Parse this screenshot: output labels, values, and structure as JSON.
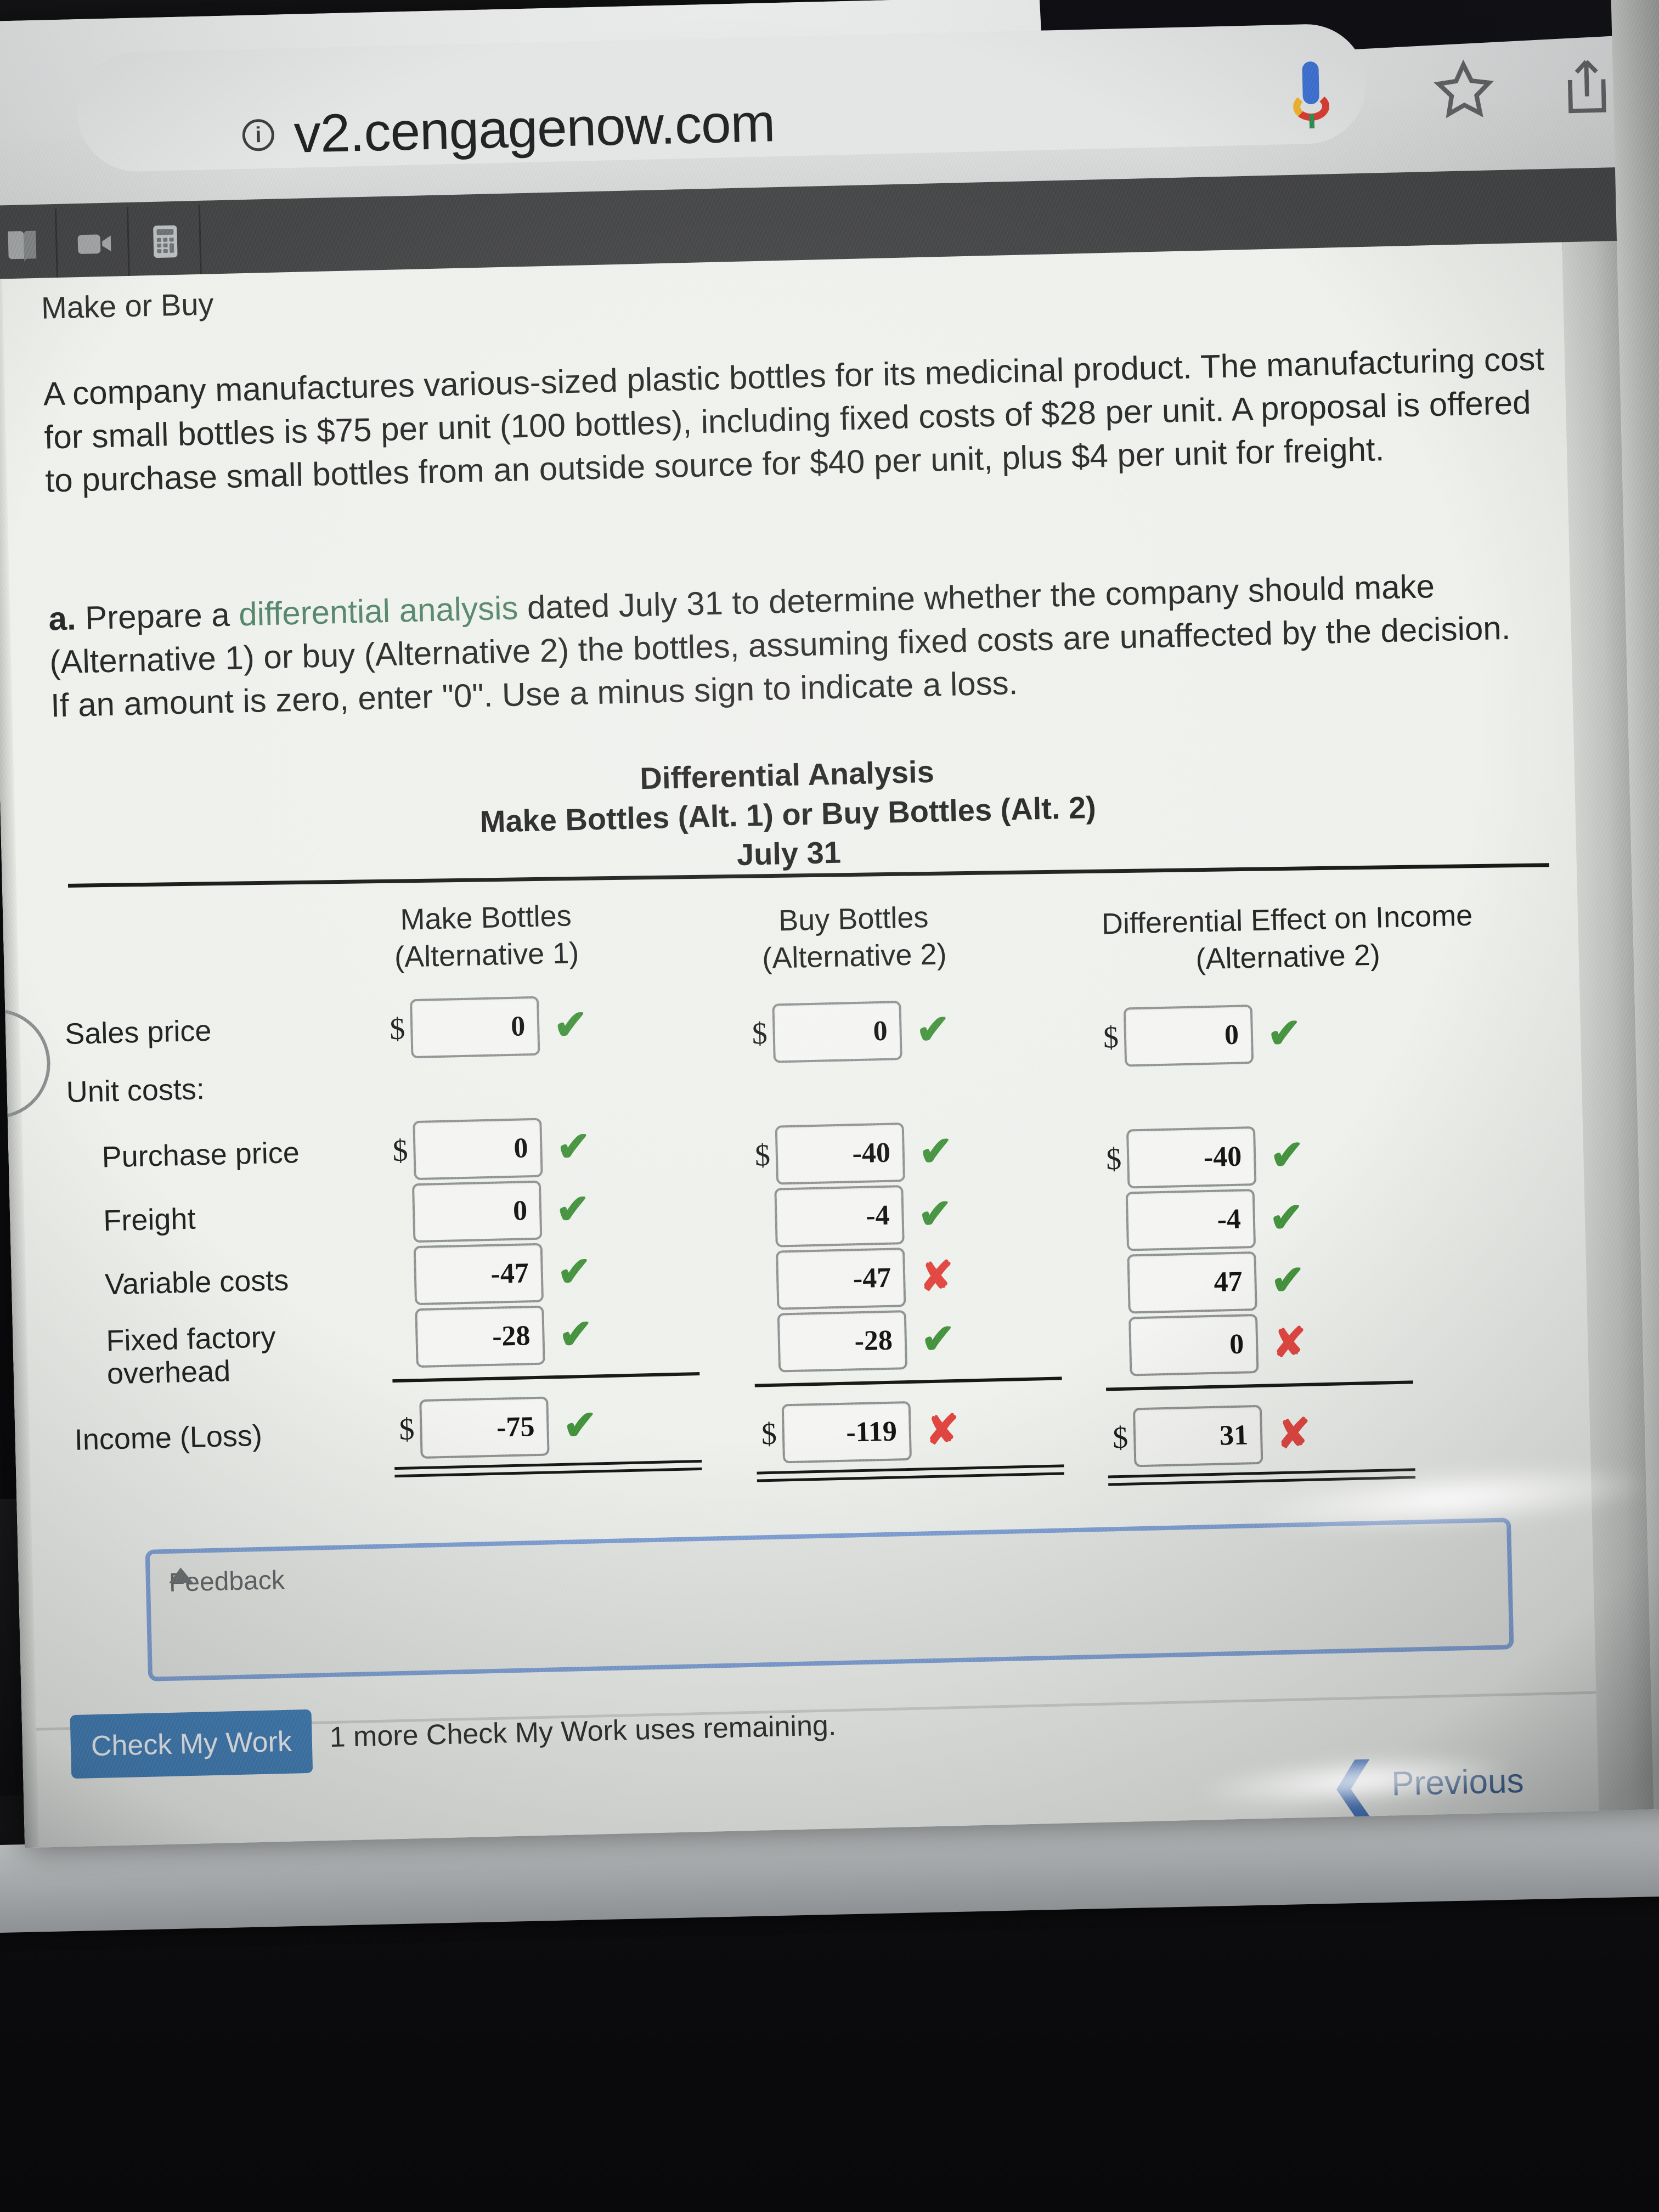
{
  "browser": {
    "url": "v2.cengagenow.com",
    "info_icon": "info-icon",
    "mic_icon": "google-mic-icon",
    "bookmark_icon": "star-icon",
    "share_icon": "share-icon"
  },
  "app_toolbar": {
    "items": [
      {
        "icon": "ebook-icon",
        "label": "eBook"
      },
      {
        "icon": "video-icon",
        "label": "Video"
      },
      {
        "icon": "calculator-icon",
        "label": "Calculator"
      }
    ]
  },
  "question": {
    "title": "Make or Buy",
    "prompt": "A company manufactures various-sized plastic bottles for its medicinal product. The manufacturing cost for small bottles is $75 per unit (100 bottles), including fixed costs of $28 per unit. A proposal is offered to purchase small bottles from an outside source for $40 per unit, plus $4 per unit for freight.",
    "part_label": "a.",
    "instruction_pre": " Prepare a ",
    "instruction_link": "differential analysis",
    "instruction_post": " dated July 31 to determine whether the company should make (Alternative 1) or buy (Alternative 2) the bottles, assuming fixed costs are unaffected by the decision. If an amount is zero, enter \"0\". Use a minus sign to indicate a loss."
  },
  "table": {
    "title_line1": "Differential Analysis",
    "title_line2": "Make Bottles (Alt. 1) or Buy Bottles (Alt. 2)",
    "title_line3": "July 31",
    "columns": [
      {
        "line1": "Make Bottles",
        "line2": "(Alternative 1)"
      },
      {
        "line1": "Buy Bottles",
        "line2": "(Alternative 2)"
      },
      {
        "line1": "Differential Effect on Income",
        "line2": "(Alternative 2)"
      }
    ],
    "rows": [
      {
        "label": "Sales price",
        "indent": false,
        "cells": [
          {
            "currency": "$",
            "value": "0",
            "status": "correct"
          },
          {
            "currency": "$",
            "value": "0",
            "status": "correct"
          },
          {
            "currency": "$",
            "value": "0",
            "status": "correct"
          }
        ]
      },
      {
        "label": "Unit costs:",
        "indent": false,
        "cells": []
      },
      {
        "label": "Purchase price",
        "indent": true,
        "cells": [
          {
            "currency": "$",
            "value": "0",
            "status": "correct"
          },
          {
            "currency": "$",
            "value": "-40",
            "status": "correct"
          },
          {
            "currency": "$",
            "value": "-40",
            "status": "correct"
          }
        ]
      },
      {
        "label": "Freight",
        "indent": true,
        "cells": [
          {
            "currency": "",
            "value": "0",
            "status": "correct"
          },
          {
            "currency": "",
            "value": "-4",
            "status": "correct"
          },
          {
            "currency": "",
            "value": "-4",
            "status": "correct"
          }
        ]
      },
      {
        "label": "Variable costs",
        "indent": true,
        "cells": [
          {
            "currency": "",
            "value": "-47",
            "status": "correct"
          },
          {
            "currency": "",
            "value": "-47",
            "status": "incorrect"
          },
          {
            "currency": "",
            "value": "47",
            "status": "correct"
          }
        ]
      },
      {
        "label": "Fixed factory overhead",
        "indent": true,
        "cells": [
          {
            "currency": "",
            "value": "-28",
            "status": "correct"
          },
          {
            "currency": "",
            "value": "-28",
            "status": "correct"
          },
          {
            "currency": "",
            "value": "0",
            "status": "incorrect"
          }
        ]
      },
      {
        "label": "Income (Loss)",
        "indent": false,
        "cells": [
          {
            "currency": "$",
            "value": "-75",
            "status": "correct"
          },
          {
            "currency": "$",
            "value": "-119",
            "status": "incorrect"
          },
          {
            "currency": "$",
            "value": "31",
            "status": "incorrect"
          }
        ]
      }
    ],
    "correct_mark": "✔",
    "incorrect_mark": "✘"
  },
  "feedback": {
    "label": "Feedback"
  },
  "footer": {
    "check_button": "Check My Work",
    "uses_remaining": "1 more Check My Work uses remaining.",
    "previous_label": "Previous",
    "previous_chevron": "❮"
  },
  "colors": {
    "correct": "#3f8f3a",
    "incorrect": "#e0413c",
    "link": "#4d7f63",
    "button": "#3e7bb5",
    "feedback_border": "#7d9fd6"
  }
}
